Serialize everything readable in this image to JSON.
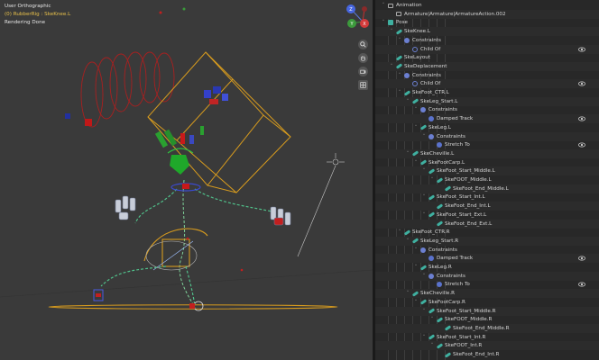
{
  "viewport": {
    "mode": "User Orthographic",
    "object": "(0) RubberRig : SkeKnee.L",
    "status": "Rendering Done",
    "nav_icons": [
      "zoom-icon",
      "hand-pan-icon",
      "grid-view-icon"
    ],
    "gizmo_axes": {
      "z": "Z",
      "y": "Y",
      "x": "X"
    }
  },
  "outliner": {
    "rows": [
      {
        "label": "Animation",
        "icon": "anim",
        "depth": 1,
        "exp": "v",
        "eye": false
      },
      {
        "label": "Armature|Armature|ArmatureAction.002",
        "icon": "anim",
        "depth": 2,
        "exp": "",
        "eye": false
      },
      {
        "label": "Pose",
        "icon": "pose",
        "depth": 1,
        "exp": "v",
        "eye": false
      },
      {
        "label": "SkeKnee.L",
        "icon": "bone",
        "depth": 2,
        "exp": "v",
        "eye": false
      },
      {
        "label": "Constraints",
        "icon": "con",
        "depth": 3,
        "exp": "v",
        "eye": false
      },
      {
        "label": "Child Of",
        "icon": "child",
        "depth": 4,
        "exp": "",
        "eye": true
      },
      {
        "label": "SkeLayout",
        "icon": "bone",
        "depth": 2,
        "exp": "",
        "eye": false
      },
      {
        "label": "SkeDeplacement",
        "icon": "bone",
        "depth": 2,
        "exp": "v",
        "eye": false
      },
      {
        "label": "Constraints",
        "icon": "con",
        "depth": 3,
        "exp": "v",
        "eye": false
      },
      {
        "label": "Child Of",
        "icon": "child",
        "depth": 4,
        "exp": "",
        "eye": true
      },
      {
        "label": "SkeFoot_CTR.L",
        "icon": "bone",
        "depth": 3,
        "exp": "v",
        "eye": false
      },
      {
        "label": "SkeLeg_Start.L",
        "icon": "bone",
        "depth": 4,
        "exp": "v",
        "eye": false
      },
      {
        "label": "Constraints",
        "icon": "con",
        "depth": 5,
        "exp": "v",
        "eye": false
      },
      {
        "label": "Damped Track",
        "icon": "track",
        "depth": 6,
        "exp": "",
        "eye": true
      },
      {
        "label": "SkeLeg.L",
        "icon": "bone",
        "depth": 5,
        "exp": "v",
        "eye": false
      },
      {
        "label": "Constraints",
        "icon": "con",
        "depth": 6,
        "exp": "v",
        "eye": false
      },
      {
        "label": "Stretch To",
        "icon": "stretch",
        "depth": 7,
        "exp": "",
        "eye": true
      },
      {
        "label": "SkeCheville.L",
        "icon": "bone",
        "depth": 4,
        "exp": "v",
        "eye": false
      },
      {
        "label": "SkeFootCarp.L",
        "icon": "bone",
        "depth": 5,
        "exp": "v",
        "eye": false
      },
      {
        "label": "SkeFoot_Start_Middle.L",
        "icon": "bone",
        "depth": 6,
        "exp": "v",
        "eye": false
      },
      {
        "label": "SkeFOOT_Middle.L",
        "icon": "bone",
        "depth": 7,
        "exp": "v",
        "eye": false
      },
      {
        "label": "SkeFoot_End_Middle.L",
        "icon": "bone",
        "depth": 8,
        "exp": "",
        "eye": false
      },
      {
        "label": "SkeFoot_Start_Int.L",
        "icon": "bone",
        "depth": 6,
        "exp": "v",
        "eye": false
      },
      {
        "label": "SkeFoot_End_Int.L",
        "icon": "bone",
        "depth": 7,
        "exp": "",
        "eye": false
      },
      {
        "label": "SkeFoot_Start_Ext.L",
        "icon": "bone",
        "depth": 6,
        "exp": "v",
        "eye": false
      },
      {
        "label": "SkeFoot_End_Ext.L",
        "icon": "bone",
        "depth": 7,
        "exp": "",
        "eye": false
      },
      {
        "label": "SkeFoot_CTR.R",
        "icon": "bone",
        "depth": 3,
        "exp": "v",
        "eye": false
      },
      {
        "label": "SkeLeg_Start.R",
        "icon": "bone",
        "depth": 4,
        "exp": "v",
        "eye": false
      },
      {
        "label": "Constraints",
        "icon": "con",
        "depth": 5,
        "exp": "v",
        "eye": false
      },
      {
        "label": "Damped Track",
        "icon": "track",
        "depth": 6,
        "exp": "",
        "eye": true
      },
      {
        "label": "SkeLeg.R",
        "icon": "bone",
        "depth": 5,
        "exp": "v",
        "eye": false
      },
      {
        "label": "Constraints",
        "icon": "con",
        "depth": 6,
        "exp": "v",
        "eye": false
      },
      {
        "label": "Stretch To",
        "icon": "stretch",
        "depth": 7,
        "exp": "",
        "eye": true
      },
      {
        "label": "SkeCheville.R",
        "icon": "bone",
        "depth": 4,
        "exp": "v",
        "eye": false
      },
      {
        "label": "SkeFootCarp.R",
        "icon": "bone",
        "depth": 5,
        "exp": "v",
        "eye": false
      },
      {
        "label": "SkeFoot_Start_Middle.R",
        "icon": "bone",
        "depth": 6,
        "exp": "v",
        "eye": false
      },
      {
        "label": "SkeFOOT_Middle.R",
        "icon": "bone",
        "depth": 7,
        "exp": "v",
        "eye": false
      },
      {
        "label": "SkeFoot_End_Middle.R",
        "icon": "bone",
        "depth": 8,
        "exp": "",
        "eye": false
      },
      {
        "label": "SkeFoot_Start_Int.R",
        "icon": "bone",
        "depth": 6,
        "exp": "v",
        "eye": false
      },
      {
        "label": "SkeFOOT_Int.R",
        "icon": "bone",
        "depth": 7,
        "exp": "v",
        "eye": false
      },
      {
        "label": "SkeFoot_End_Int.R",
        "icon": "bone",
        "depth": 8,
        "exp": "",
        "eye": false
      }
    ]
  },
  "colors": {
    "viewport_bg": "#3a3a3a",
    "outliner_bg": "#282828",
    "bone_teal": "#3fb0a0",
    "constraint_blue": "#6b7fd1",
    "selection_yellow": "#e0a020",
    "red_circles": "#b02020"
  }
}
